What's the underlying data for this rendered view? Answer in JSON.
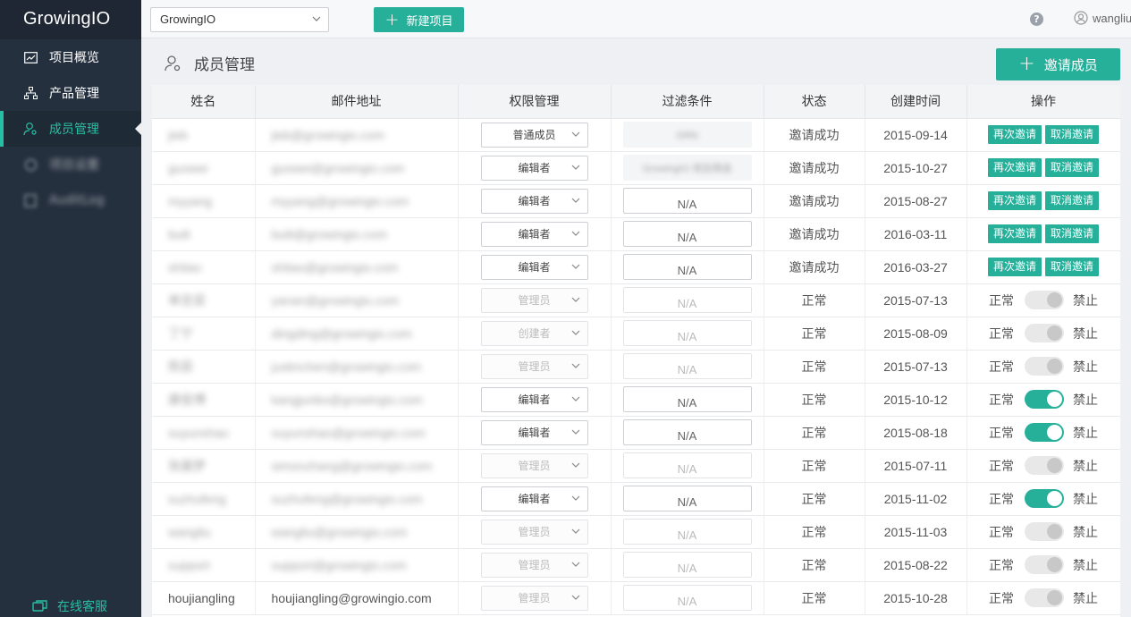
{
  "app": {
    "logo": "GrowingIO"
  },
  "sidebar": {
    "items": [
      {
        "label": "项目概览",
        "icon": "chart-icon",
        "active": false,
        "blurred": false
      },
      {
        "label": "产品管理",
        "icon": "hierarchy-icon",
        "active": false,
        "blurred": false
      },
      {
        "label": "成员管理",
        "icon": "member-icon",
        "active": true,
        "blurred": false
      },
      {
        "label": "项目设置",
        "icon": "settings-icon",
        "active": false,
        "blurred": true
      },
      {
        "label": "AuditLog",
        "icon": "log-icon",
        "active": false,
        "blurred": true
      }
    ],
    "online_service": "在线客服"
  },
  "topbar": {
    "project_select": "GrowingIO",
    "new_project": "新建项目",
    "help": "?",
    "user": "wangliu"
  },
  "page": {
    "title": "成员管理",
    "invite_button": "邀请成员"
  },
  "table": {
    "headers": [
      "姓名",
      "邮件地址",
      "权限管理",
      "过滤条件",
      "状态",
      "创建时间",
      "操作"
    ],
    "labels": {
      "reinvite": "再次邀请",
      "cancel_invite": "取消邀请",
      "normal": "正常",
      "forbid": "禁止"
    },
    "rows": [
      {
        "name": "jieb",
        "email": "jieb@growingio.com",
        "role": "普通成员",
        "role_disabled": false,
        "filter": "GRN",
        "filter_type": "blur",
        "status": "邀请成功",
        "created": "2015-09-14",
        "mode": "invite",
        "enabled": false,
        "blur": true
      },
      {
        "name": "guowei",
        "email": "guowei@growingio.com",
        "role": "编辑者",
        "role_disabled": false,
        "filter": "GrowingIO 项目筛选",
        "filter_type": "blur",
        "status": "邀请成功",
        "created": "2015-10-27",
        "mode": "invite",
        "enabled": false,
        "blur": true
      },
      {
        "name": "myyang",
        "email": "myyang@growingio.com",
        "role": "编辑者",
        "role_disabled": false,
        "filter": "N/A",
        "filter_type": "box",
        "status": "邀请成功",
        "created": "2015-08-27",
        "mode": "invite",
        "enabled": false,
        "blur": true
      },
      {
        "name": "buili",
        "email": "buili@growingio.com",
        "role": "编辑者",
        "role_disabled": false,
        "filter": "N/A",
        "filter_type": "box",
        "status": "邀请成功",
        "created": "2016-03-11",
        "mode": "invite",
        "enabled": false,
        "blur": true
      },
      {
        "name": "shitao",
        "email": "shitao@growingio.com",
        "role": "编辑者",
        "role_disabled": false,
        "filter": "N/A",
        "filter_type": "box",
        "status": "邀请成功",
        "created": "2016-03-27",
        "mode": "invite",
        "enabled": false,
        "blur": true
      },
      {
        "name": "单忠梁",
        "email": "yanan@growingio.com",
        "role": "管理员",
        "role_disabled": true,
        "filter": "N/A",
        "filter_type": "dis",
        "status": "正常",
        "created": "2015-07-13",
        "mode": "toggle",
        "enabled": false,
        "blur": true
      },
      {
        "name": "丁宁",
        "email": "dingding@growingio.com",
        "role": "创建者",
        "role_disabled": true,
        "filter": "N/A",
        "filter_type": "dis",
        "status": "正常",
        "created": "2015-08-09",
        "mode": "toggle",
        "enabled": false,
        "blur": true
      },
      {
        "name": "陈辰",
        "email": "justinchen@growingio.com",
        "role": "管理员",
        "role_disabled": true,
        "filter": "N/A",
        "filter_type": "dis",
        "status": "正常",
        "created": "2015-07-13",
        "mode": "toggle",
        "enabled": false,
        "blur": true
      },
      {
        "name": "康俊博",
        "email": "kangjunbo@growingio.com",
        "role": "编辑者",
        "role_disabled": false,
        "filter": "N/A",
        "filter_type": "box",
        "status": "正常",
        "created": "2015-10-12",
        "mode": "toggle",
        "enabled": true,
        "blur": true
      },
      {
        "name": "suyunshao",
        "email": "suyunshao@growingio.com",
        "role": "编辑者",
        "role_disabled": false,
        "filter": "N/A",
        "filter_type": "box",
        "status": "正常",
        "created": "2015-08-18",
        "mode": "toggle",
        "enabled": true,
        "blur": true
      },
      {
        "name": "张晨梦",
        "email": "simonzhang@growingio.com",
        "role": "管理员",
        "role_disabled": true,
        "filter": "N/A",
        "filter_type": "dis",
        "status": "正常",
        "created": "2015-07-11",
        "mode": "toggle",
        "enabled": false,
        "blur": true
      },
      {
        "name": "suzhufeng",
        "email": "suzhufeng@growingio.com",
        "role": "编辑者",
        "role_disabled": false,
        "filter": "N/A",
        "filter_type": "box",
        "status": "正常",
        "created": "2015-11-02",
        "mode": "toggle",
        "enabled": true,
        "blur": true
      },
      {
        "name": "wangliu",
        "email": "wangliu@growingio.com",
        "role": "管理员",
        "role_disabled": true,
        "filter": "N/A",
        "filter_type": "dis",
        "status": "正常",
        "created": "2015-11-03",
        "mode": "toggle",
        "enabled": false,
        "blur": true
      },
      {
        "name": "support",
        "email": "support@growingio.com",
        "role": "管理员",
        "role_disabled": true,
        "filter": "N/A",
        "filter_type": "dis",
        "status": "正常",
        "created": "2015-08-22",
        "mode": "toggle",
        "enabled": false,
        "blur": true
      },
      {
        "name": "houjiangling",
        "email": "houjiangling@growingio.com",
        "role": "管理员",
        "role_disabled": true,
        "filter": "N/A",
        "filter_type": "dis",
        "status": "正常",
        "created": "2015-10-28",
        "mode": "toggle",
        "enabled": false,
        "blur": false
      }
    ]
  },
  "colors": {
    "accent": "#26b09a",
    "sidebar": "#25303f",
    "active_text": "#26bfa3"
  }
}
